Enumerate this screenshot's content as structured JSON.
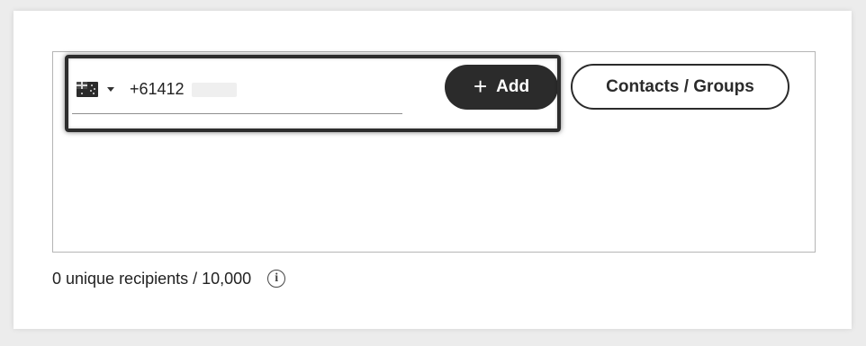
{
  "recipient_input": {
    "country": {
      "flag_icon": "australia-flag-icon",
      "dropdown_icon": "caret-down-icon"
    },
    "phone_value": "+61412"
  },
  "actions": {
    "add_label": "Add",
    "add_icon": "plus-icon",
    "contacts_label": "Contacts / Groups"
  },
  "footer": {
    "recipient_count_text": "0 unique recipients / 10,000",
    "info_icon": "info-icon",
    "info_glyph": "i"
  }
}
